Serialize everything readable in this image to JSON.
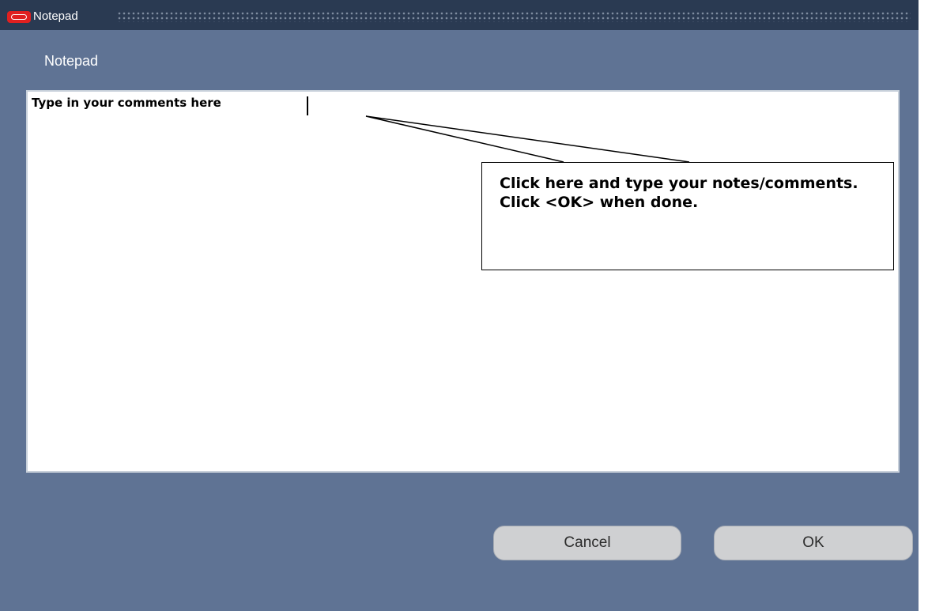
{
  "window": {
    "title": "Notepad"
  },
  "section": {
    "label": "Notepad"
  },
  "notes": {
    "value": "Type in your comments here"
  },
  "callout": {
    "text": "Click here and type your notes/comments.  Click <OK> when done."
  },
  "buttons": {
    "cancel_label": "Cancel",
    "ok_label": "OK"
  },
  "colors": {
    "window_bg": "#5f7394",
    "titlebar_bg": "#2a3a52",
    "logo_red": "#e02020",
    "button_bg": "#cfd0d2"
  },
  "icons": {
    "app_logo": "oracle-logo-icon"
  }
}
